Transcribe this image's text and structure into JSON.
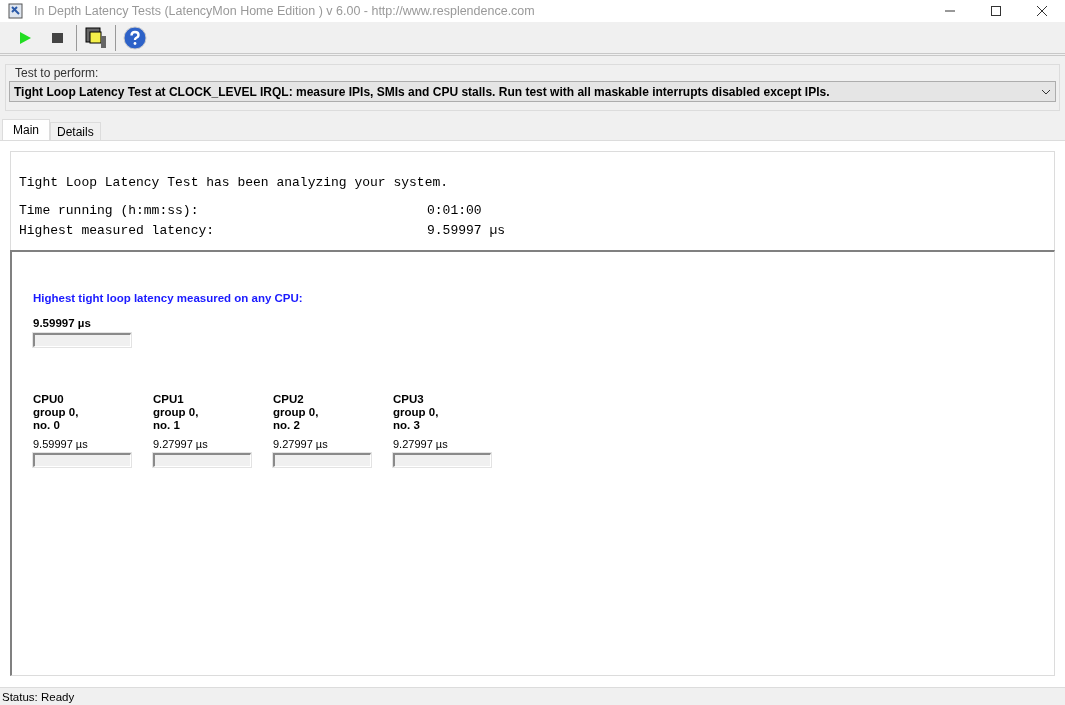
{
  "window": {
    "title": "In Depth Latency Tests  (LatencyMon Home Edition )  v 6.00 - http://www.resplendence.com"
  },
  "test_select": {
    "label": "Test to perform:",
    "value": "Tight Loop Latency Test at CLOCK_LEVEL IRQL: measure IPIs, SMIs and CPU stalls. Run test with all maskable interrupts disabled except IPIs."
  },
  "tabs": [
    {
      "label": "Main",
      "selected": true
    },
    {
      "label": "Details",
      "selected": false
    }
  ],
  "summary": {
    "headline": "Tight Loop Latency Test has been analyzing your system.",
    "rows": [
      {
        "label": "Time running (h:mm:ss):",
        "value": "0:01:00"
      },
      {
        "label": "Highest measured latency:",
        "value": "9.59997 µs"
      }
    ]
  },
  "highest": {
    "title": "Highest tight loop latency measured on any CPU:",
    "value": "9.59997 µs",
    "level": 0
  },
  "cpus": [
    {
      "name": "CPU0",
      "group": "group 0,",
      "number": "no. 0",
      "value": "9.59997 µs",
      "level": 0
    },
    {
      "name": "CPU1",
      "group": "group 0,",
      "number": "no. 1",
      "value": "9.27997 µs",
      "level": 0
    },
    {
      "name": "CPU2",
      "group": "group 0,",
      "number": "no. 2",
      "value": "9.27997 µs",
      "level": 0
    },
    {
      "name": "CPU3",
      "group": "group 0,",
      "number": "no. 3",
      "value": "9.27997 µs",
      "level": 0
    }
  ],
  "status_bar": "Status: Ready"
}
